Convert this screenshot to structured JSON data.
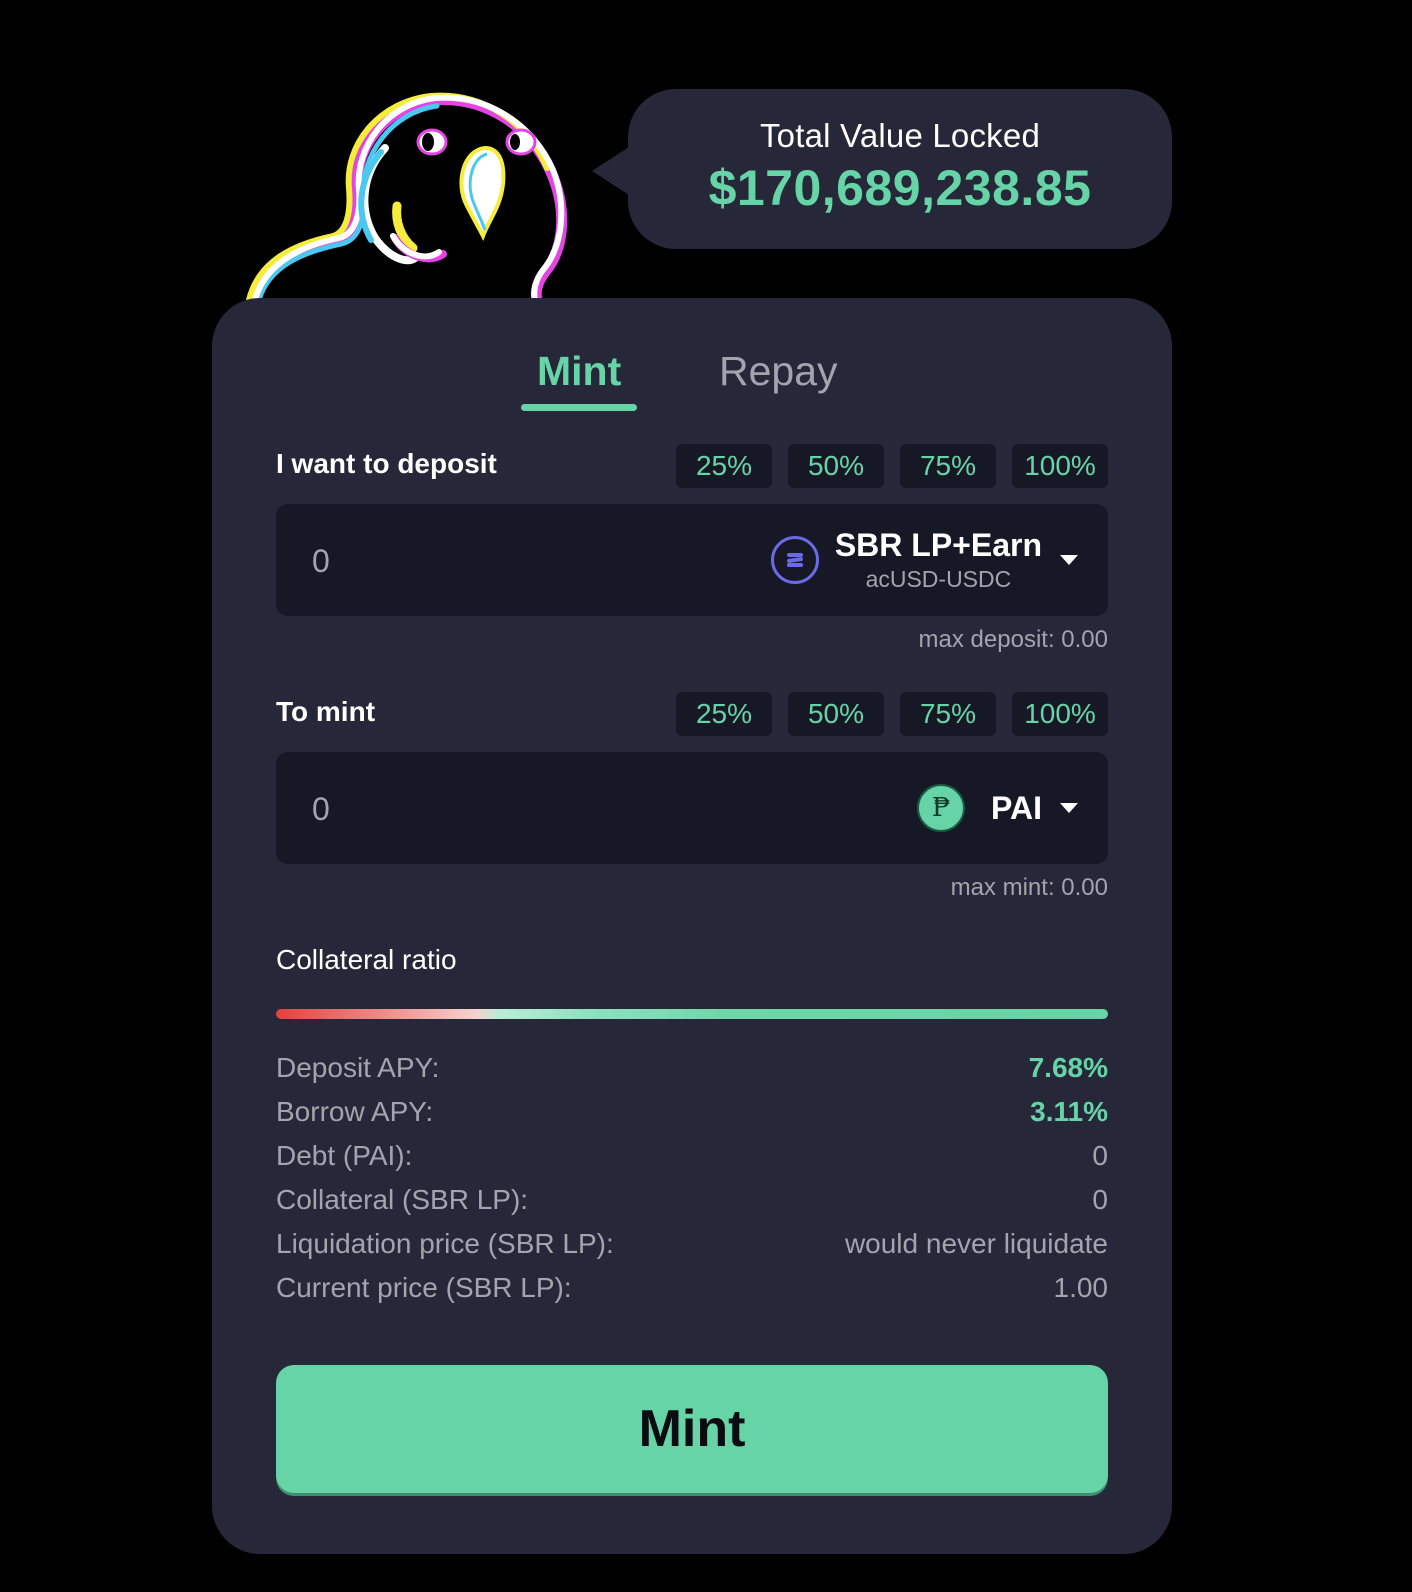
{
  "mascot": {
    "icon": "parrot-mascot-icon"
  },
  "tvl": {
    "label": "Total Value Locked",
    "value": "$170,689,238.85"
  },
  "tabs": [
    {
      "label": "Mint",
      "active": true
    },
    {
      "label": "Repay",
      "active": false
    }
  ],
  "deposit": {
    "label": "I want to deposit",
    "percent_buttons": [
      "25%",
      "50%",
      "75%",
      "100%"
    ],
    "amount": "0",
    "token": {
      "icon": "saber-token-icon",
      "name": "SBR LP+Earn",
      "sub": "acUSD-USDC"
    },
    "max_note": "max deposit: 0.00"
  },
  "mint": {
    "label": "To mint",
    "percent_buttons": [
      "25%",
      "50%",
      "75%",
      "100%"
    ],
    "amount": "0",
    "token": {
      "icon": "pai-token-icon",
      "symbol_glyph": "₱",
      "name": "PAI"
    },
    "max_note": "max mint: 0.00"
  },
  "collateral_ratio": {
    "label": "Collateral ratio"
  },
  "stats": [
    {
      "label": "Deposit APY:",
      "value": "7.68%",
      "highlight": true
    },
    {
      "label": "Borrow APY:",
      "value": "3.11%",
      "highlight": true
    },
    {
      "label": "Debt (PAI):",
      "value": "0",
      "highlight": false
    },
    {
      "label": "Collateral (SBR LP):",
      "value": "0",
      "highlight": false
    },
    {
      "label": "Liquidation price (SBR LP):",
      "value": "would never liquidate",
      "highlight": false
    },
    {
      "label": "Current price (SBR LP):",
      "value": "1.00",
      "highlight": false
    }
  ],
  "action_button": {
    "label": "Mint"
  },
  "colors": {
    "background": "#000000",
    "card": "#262839",
    "input": "#171826",
    "accent": "#66d4a6",
    "muted_text": "#a3a4ad",
    "danger": "#e5403f"
  }
}
